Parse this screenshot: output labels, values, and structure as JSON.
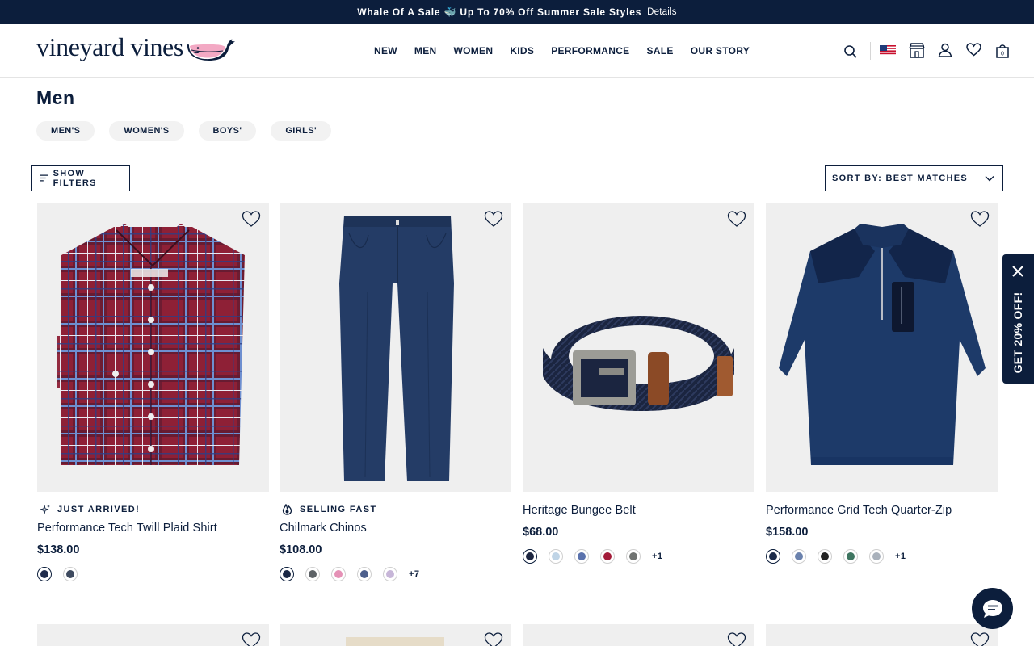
{
  "promo_bar": {
    "message": "Whale Of A Sale 🐳 Up To 70% Off Summer Sale Styles",
    "details_label": "Details"
  },
  "header": {
    "logo_text": "vineyard vines",
    "nav": [
      "NEW",
      "MEN",
      "WOMEN",
      "KIDS",
      "PERFORMANCE",
      "SALE",
      "OUR STORY"
    ],
    "icons": [
      "search-icon",
      "us-flag-icon",
      "store-icon",
      "account-icon",
      "wishlist-heart-icon",
      "bag-icon"
    ],
    "bag_count": "0"
  },
  "page": {
    "title": "Men",
    "chips": [
      "MEN'S",
      "WOMEN'S",
      "BOYS'",
      "GIRLS'"
    ],
    "filters_label": "SHOW FILTERS",
    "sort_label": "SORT BY: BEST MATCHES"
  },
  "products": [
    {
      "badge": "JUST ARRIVED!",
      "badge_icon": "sparkle-icon",
      "name": "Performance Tech Twill Plaid Shirt",
      "price": "$138.00",
      "swatches": [
        "#1f2b4b",
        "#3e4a5f"
      ],
      "more": ""
    },
    {
      "badge": "SELLING FAST",
      "badge_icon": "flame-icon",
      "name": "Chilmark Chinos",
      "price": "$108.00",
      "swatches": [
        "#1a2744",
        "#5d6266",
        "#e591b6",
        "#4c5f8c",
        "#c7b6d8"
      ],
      "more": "+7"
    },
    {
      "badge": "",
      "badge_icon": "",
      "name": "Heritage Bungee Belt",
      "price": "$68.00",
      "swatches": [
        "#1c2540",
        "#bfd4e6",
        "#5a72ad",
        "#a31b39",
        "#6f7270"
      ],
      "more": "+1"
    },
    {
      "badge": "",
      "badge_icon": "",
      "name": "Performance Grid Tech Quarter-Zip",
      "price": "$158.00",
      "swatches": [
        "#1c2b4a",
        "#6b82ad",
        "#232323",
        "#3e7560",
        "#a9b1bb"
      ],
      "more": "+1"
    }
  ],
  "promo_tab": {
    "label": "GET 20% OFF!"
  },
  "colors": {
    "navy": "#0c1e3c",
    "tile_bg": "#efefef"
  }
}
